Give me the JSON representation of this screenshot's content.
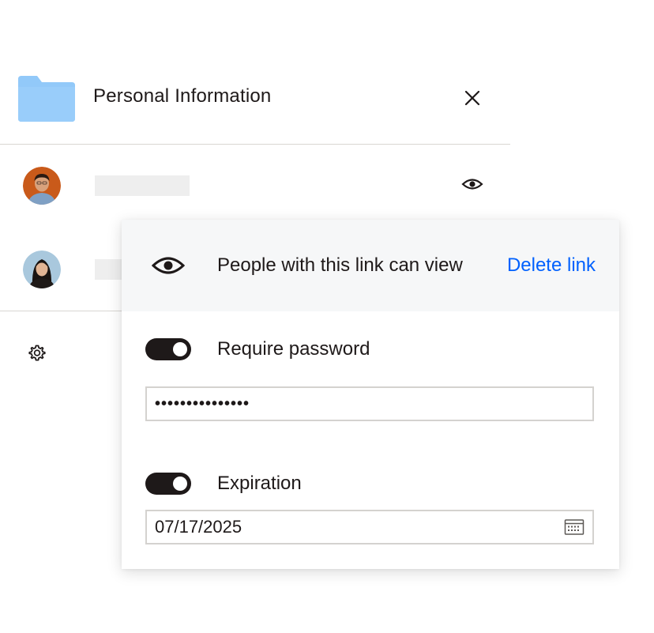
{
  "header": {
    "title": "Personal Information",
    "folder_icon": "folder-icon",
    "close_icon": "close-icon"
  },
  "members": [
    {
      "avatar_color": "#c95a1a",
      "access_icon": "eye-icon"
    },
    {
      "avatar_color": "#a9c8dd"
    }
  ],
  "settings_icon": "gear-icon",
  "link_popover": {
    "permission_text": "People with this link can view",
    "delete_link_label": "Delete link",
    "require_password": {
      "label": "Require password",
      "enabled": true,
      "value": "•••••••••••••••"
    },
    "expiration": {
      "label": "Expiration",
      "enabled": true,
      "value": "07/17/2025",
      "calendar_icon": "calendar-icon"
    }
  },
  "colors": {
    "accent_link": "#0061fe",
    "toggle_on": "#1e1919",
    "folder": "#92c9f9",
    "popover_header_bg": "#f6f7f8"
  }
}
